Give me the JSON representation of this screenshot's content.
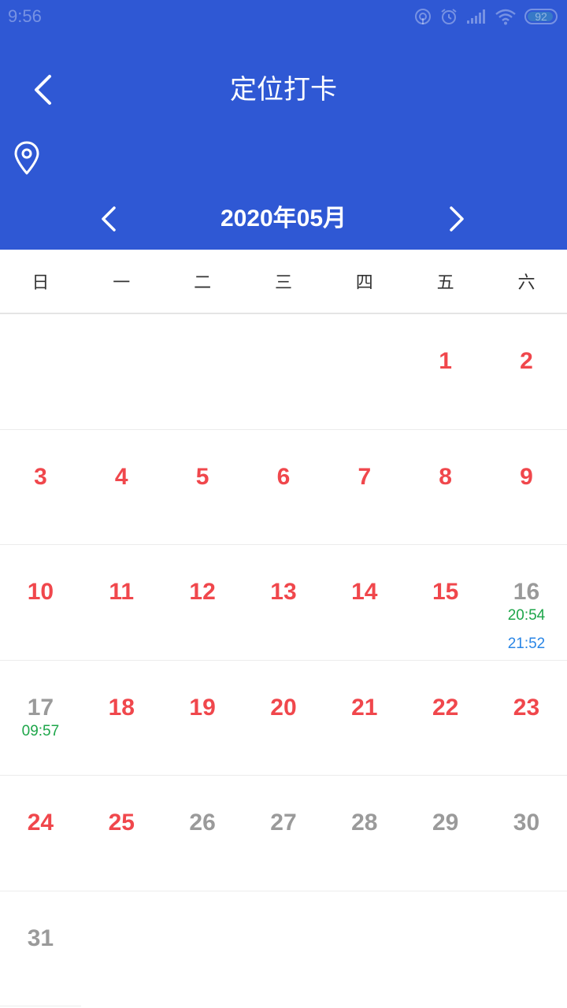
{
  "status_bar": {
    "time": "9:56",
    "battery": "92"
  },
  "header": {
    "title": "定位打卡"
  },
  "month_nav": {
    "label": "2020年05月"
  },
  "weekdays": [
    "日",
    "一",
    "二",
    "三",
    "四",
    "五",
    "六"
  ],
  "colors": {
    "header": "#2f58d4",
    "day_red": "#f0474c",
    "day_gray": "#9a9a9a",
    "punch_green": "#1ea64a",
    "punch_blue": "#2a86e6"
  },
  "weeks": [
    [
      "",
      "",
      "",
      "",
      "",
      "1",
      "2"
    ],
    [
      "3",
      "4",
      "5",
      "6",
      "7",
      "8",
      "9"
    ],
    [
      "10",
      "11",
      "12",
      "13",
      "14",
      "15",
      "16"
    ],
    [
      "17",
      "18",
      "19",
      "20",
      "21",
      "22",
      "23"
    ],
    [
      "24",
      "25",
      "26",
      "27",
      "28",
      "29",
      "30"
    ],
    [
      "31",
      "",
      "",
      "",
      "",
      "",
      ""
    ]
  ],
  "punches": {
    "d16": {
      "first": "20:54",
      "second": "21:52"
    },
    "d17": {
      "first": "09:57"
    }
  }
}
